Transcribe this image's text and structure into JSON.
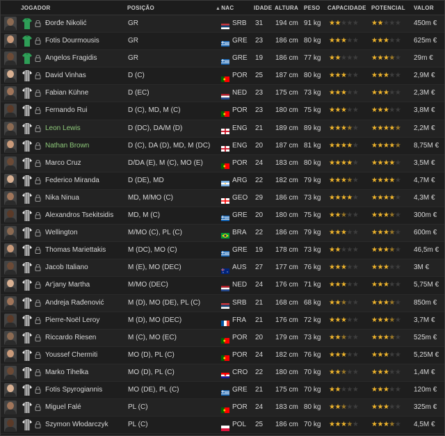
{
  "columns": {
    "player": "JOGADOR",
    "position": "POSIÇÃO",
    "nation": "NAC",
    "age": "IDADE",
    "height": "ALTURA",
    "weight": "PESO",
    "ability": "CAPACIDADE",
    "potential": "POTENCIAL",
    "value": "VALOR"
  },
  "sort": {
    "column": "nation",
    "direction": "ascending"
  },
  "colors": {
    "star": "#f0b52c",
    "empty_star": "#3e3e3e",
    "loan_name": "#8ec97a",
    "gk_shirt": "#2e9e57"
  },
  "players": [
    {
      "name": "Đorđe Nikolić",
      "position": "GR",
      "nation": "SRB",
      "age": "31",
      "height": "194 cm",
      "weight": "91 kg",
      "ability": 2,
      "potential": 2,
      "value": "450m €",
      "shirt": "gk",
      "name_color": "default"
    },
    {
      "name": "Fotis Dourmousis",
      "position": "GR",
      "nation": "GRE",
      "age": "23",
      "height": "186 cm",
      "weight": "80 kg",
      "ability": 3,
      "potential": 3,
      "value": "625m €",
      "shirt": "gk",
      "name_color": "default"
    },
    {
      "name": "Angelos Fragidis",
      "position": "GR",
      "nation": "GRE",
      "age": "19",
      "height": "186 cm",
      "weight": "77 kg",
      "ability": 2,
      "potential": 3.5,
      "value": "29m €",
      "shirt": "gk",
      "name_color": "default"
    },
    {
      "name": "David Vinhas",
      "position": "D (C)",
      "nation": "POR",
      "age": "25",
      "height": "187 cm",
      "weight": "80 kg",
      "ability": 3,
      "potential": 3,
      "value": "2,9M €",
      "shirt": "field",
      "name_color": "default"
    },
    {
      "name": "Fabian Kühne",
      "position": "D (EC)",
      "nation": "NED",
      "age": "23",
      "height": "175 cm",
      "weight": "73 kg",
      "ability": 3,
      "potential": 3,
      "value": "2,3M €",
      "shirt": "field",
      "name_color": "default"
    },
    {
      "name": "Fernando Rui",
      "position": "D (C), MD, M (C)",
      "nation": "POR",
      "age": "23",
      "height": "180 cm",
      "weight": "75 kg",
      "ability": 3,
      "potential": 3,
      "value": "3,8M €",
      "shirt": "field",
      "name_color": "default"
    },
    {
      "name": "Leon Lewis",
      "position": "D (DC), DA/M (D)",
      "nation": "ENG",
      "age": "21",
      "height": "189 cm",
      "weight": "89 kg",
      "ability": 3.5,
      "potential": 4.5,
      "value": "2,2M €",
      "shirt": "field",
      "name_color": "green"
    },
    {
      "name": "Nathan Brown",
      "position": "D (C), DA (D), MD, M (DC)",
      "nation": "ENG",
      "age": "20",
      "height": "187 cm",
      "weight": "81 kg",
      "ability": 4,
      "potential": 4.5,
      "value": "8,75M €",
      "shirt": "field",
      "name_color": "green"
    },
    {
      "name": "Marco Cruz",
      "position": "D/DA (E), M (C), MO (E)",
      "nation": "POR",
      "age": "24",
      "height": "183 cm",
      "weight": "80 kg",
      "ability": 4,
      "potential": 4,
      "value": "3,5M €",
      "shirt": "field",
      "name_color": "default"
    },
    {
      "name": "Federico Miranda",
      "position": "D (DE), MD",
      "nation": "ARG",
      "age": "22",
      "height": "182 cm",
      "weight": "79 kg",
      "ability": 3.5,
      "potential": 4,
      "value": "4,7M €",
      "shirt": "field",
      "name_color": "default"
    },
    {
      "name": "Nika Ninua",
      "position": "MD, M/MO (C)",
      "nation": "GEO",
      "age": "29",
      "height": "186 cm",
      "weight": "73 kg",
      "ability": 4,
      "potential": 4,
      "value": "4,3M €",
      "shirt": "field",
      "name_color": "default"
    },
    {
      "name": "Alexandros Tsekitsidis",
      "position": "MD, M (C)",
      "nation": "GRE",
      "age": "20",
      "height": "180 cm",
      "weight": "75 kg",
      "ability": 2.5,
      "potential": 3.5,
      "value": "300m €",
      "shirt": "field",
      "name_color": "default"
    },
    {
      "name": "Wellington",
      "position": "M/MO (C), PL (C)",
      "nation": "BRA",
      "age": "22",
      "height": "186 cm",
      "weight": "79 kg",
      "ability": 3,
      "potential": 3.5,
      "value": "600m €",
      "shirt": "field",
      "name_color": "default"
    },
    {
      "name": "Thomas Mariettakis",
      "position": "M (DC), MO (C)",
      "nation": "GRE",
      "age": "19",
      "height": "178 cm",
      "weight": "73 kg",
      "ability": 2,
      "potential": 3.5,
      "value": "46,5m €",
      "shirt": "field",
      "name_color": "default"
    },
    {
      "name": "Jacob Italiano",
      "position": "M (E), MO (DEC)",
      "nation": "AUS",
      "age": "27",
      "height": "177 cm",
      "weight": "76 kg",
      "ability": 3,
      "potential": 3,
      "value": "3M €",
      "shirt": "field",
      "name_color": "default"
    },
    {
      "name": "Ar'jany Martha",
      "position": "M/MO (DEC)",
      "nation": "NED",
      "age": "24",
      "height": "176 cm",
      "weight": "71 kg",
      "ability": 3,
      "potential": 3,
      "value": "5,75M €",
      "shirt": "field",
      "name_color": "default"
    },
    {
      "name": "Andreja Rađenović",
      "position": "M (D), MO (DE), PL (C)",
      "nation": "SRB",
      "age": "21",
      "height": "168 cm",
      "weight": "68 kg",
      "ability": 2.5,
      "potential": 3.5,
      "value": "850m €",
      "shirt": "field",
      "name_color": "default"
    },
    {
      "name": "Pierre-Noël Leroy",
      "position": "M (D), MO (DEC)",
      "nation": "FRA",
      "age": "21",
      "height": "176 cm",
      "weight": "72 kg",
      "ability": 3,
      "potential": 3.5,
      "value": "3,7M €",
      "shirt": "field",
      "name_color": "default"
    },
    {
      "name": "Riccardo Riesen",
      "position": "M (C), MO (EC)",
      "nation": "POR",
      "age": "20",
      "height": "179 cm",
      "weight": "73 kg",
      "ability": 2.5,
      "potential": 3.5,
      "value": "525m €",
      "shirt": "field",
      "name_color": "default"
    },
    {
      "name": "Youssef Chermiti",
      "position": "MO (D), PL (C)",
      "nation": "POR",
      "age": "24",
      "height": "182 cm",
      "weight": "76 kg",
      "ability": 3,
      "potential": 3,
      "value": "5,25M €",
      "shirt": "field",
      "name_color": "default"
    },
    {
      "name": "Marko Tihelka",
      "position": "MO (D), PL (C)",
      "nation": "CRO",
      "age": "22",
      "height": "180 cm",
      "weight": "70 kg",
      "ability": 2.5,
      "potential": 3,
      "value": "1,4M €",
      "shirt": "field",
      "name_color": "default"
    },
    {
      "name": "Fotis Spyrogiannis",
      "position": "MO (DE), PL (C)",
      "nation": "GRE",
      "age": "21",
      "height": "175 cm",
      "weight": "70 kg",
      "ability": 2,
      "potential": 3,
      "value": "120m €",
      "shirt": "field",
      "name_color": "default"
    },
    {
      "name": "Miguel Falé",
      "position": "PL (C)",
      "nation": "POR",
      "age": "24",
      "height": "183 cm",
      "weight": "80 kg",
      "ability": 2.5,
      "potential": 3,
      "value": "325m €",
      "shirt": "field",
      "name_color": "default"
    },
    {
      "name": "Szymon Włodarczyk",
      "position": "PL (C)",
      "nation": "POL",
      "age": "25",
      "height": "186 cm",
      "weight": "70 kg",
      "ability": 3.5,
      "potential": 3.5,
      "value": "4,5M €",
      "shirt": "field",
      "name_color": "default"
    }
  ]
}
